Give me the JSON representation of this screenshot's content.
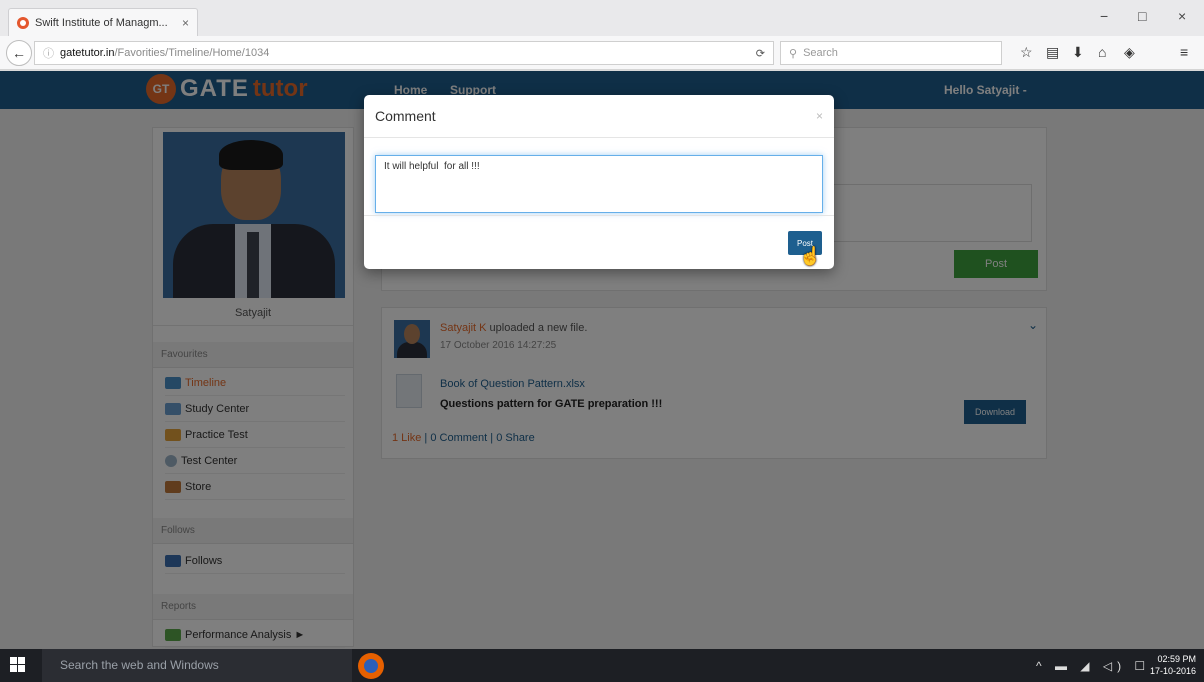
{
  "browser": {
    "tab_title": "Swift Institute of Managm...",
    "tab_close": "×",
    "url_domain": "gatetutor.in",
    "url_path": "/Favorities/Timeline/Home/1034",
    "search_placeholder": "Search",
    "window_controls": [
      "−",
      "□",
      "×"
    ]
  },
  "site": {
    "logo_badge": "GT",
    "logo_gate": "GATE",
    "logo_tutor": "tutor",
    "nav": [
      "Home",
      "Support"
    ],
    "greeting": "Hello Satyajit -"
  },
  "sidebar": {
    "user_name": "Satyajit",
    "sections": [
      {
        "title": "Favourites",
        "items": [
          "Timeline",
          "Study Center",
          "Practice Test",
          "Test Center",
          "Store"
        ]
      },
      {
        "title": "Follows",
        "items": [
          "Follows"
        ]
      },
      {
        "title": "Reports",
        "items": [
          "Performance Analysis ►"
        ]
      }
    ]
  },
  "post_box": {
    "post_label": "Post"
  },
  "feed": {
    "author": "Satyajit K",
    "action": "uploaded a new file.",
    "date": "17 October 2016 14:27:25",
    "file_name": "Book of Question Pattern.xlsx",
    "description": "Questions pattern for GATE preparation !!!",
    "download_label": "Download",
    "likes": "1 Like",
    "comments": "0 Comment",
    "shares": "0 Share"
  },
  "modal": {
    "title": "Comment",
    "close": "×",
    "comment_text": "It will helpful  for all !!!",
    "post_label": "Post"
  },
  "taskbar": {
    "search_text": "Search the web and Windows",
    "time": "02:59 PM",
    "date": "17-10-2016"
  },
  "colors": {
    "header_blue": "#1e5f8f",
    "accent_orange": "#e86a2a",
    "post_green": "#3fa33f"
  }
}
